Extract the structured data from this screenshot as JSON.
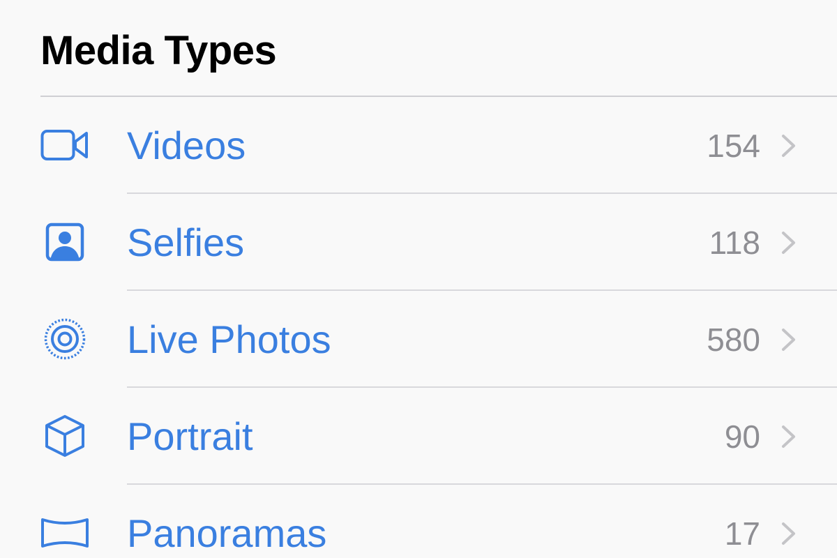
{
  "section": {
    "title": "Media Types"
  },
  "accent_color": "#3a7fe0",
  "count_color": "#8e8e93",
  "items": [
    {
      "label": "Videos",
      "count": "154",
      "icon": "video-camera-icon"
    },
    {
      "label": "Selfies",
      "count": "118",
      "icon": "selfie-portrait-icon"
    },
    {
      "label": "Live Photos",
      "count": "580",
      "icon": "live-photo-icon"
    },
    {
      "label": "Portrait",
      "count": "90",
      "icon": "cube-icon"
    },
    {
      "label": "Panoramas",
      "count": "17",
      "icon": "panorama-icon"
    }
  ]
}
